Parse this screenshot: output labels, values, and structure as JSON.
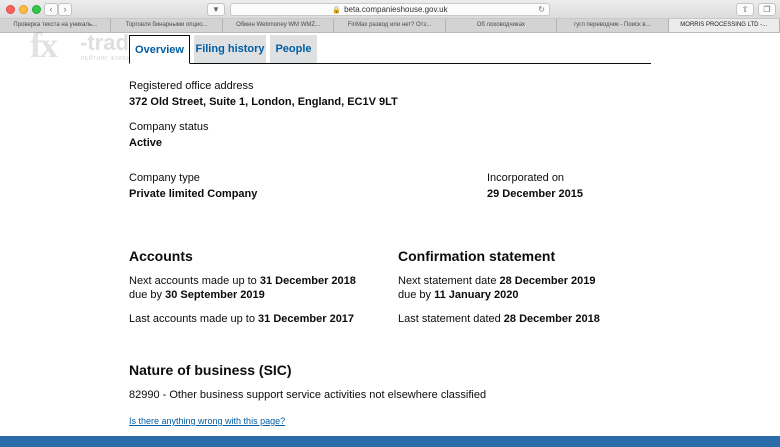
{
  "browser": {
    "address": "beta.companieshouse.gov.uk",
    "tabs": [
      {
        "label": "Проверка текста на уникаль..."
      },
      {
        "label": "Торговля бинарными опцио..."
      },
      {
        "label": "Обмен Webmoney WM WMZ..."
      },
      {
        "label": "FinMax развод или нет? Отз..."
      },
      {
        "label": "Об лоховодчиках"
      },
      {
        "label": "гугл переводчик - Поиск в..."
      },
      {
        "label": "MORRIS PROCESSING LTD -..."
      }
    ],
    "active_tab": 6
  },
  "watermark": {
    "fx": "fx",
    "traders": "-traders",
    "subtitle": "РЕЙТИНГ ФОРЕКС БРОКЕРОВ"
  },
  "page_tabs": [
    {
      "label": "Overview"
    },
    {
      "label": "Filing history"
    },
    {
      "label": "People"
    }
  ],
  "registered_office": {
    "label": "Registered office address",
    "value": "372 Old Street, Suite 1, London, England, EC1V 9LT"
  },
  "company_status": {
    "label": "Company status",
    "value": "Active"
  },
  "company_type": {
    "label": "Company type",
    "value": "Private limited Company"
  },
  "incorporated": {
    "label": "Incorporated on",
    "value": "29 December 2015"
  },
  "accounts": {
    "heading": "Accounts",
    "next_prefix": "Next accounts made up to ",
    "next_date": "31 December 2018",
    "due_prefix": "due by ",
    "due_date": "30 September 2019",
    "last_prefix": "Last accounts made up to ",
    "last_date": "31 December 2017"
  },
  "confirmation": {
    "heading": "Confirmation statement",
    "next_prefix": "Next statement date ",
    "next_date": "28 December 2019",
    "due_prefix": "due by ",
    "due_date": "11 January 2020",
    "last_prefix": "Last statement dated ",
    "last_date": "28 December 2018"
  },
  "nature": {
    "heading": "Nature of business (SIC)",
    "value": "82990 - Other business support service activities not elsewhere classified"
  },
  "report_link": "Is there anything wrong with this page?"
}
